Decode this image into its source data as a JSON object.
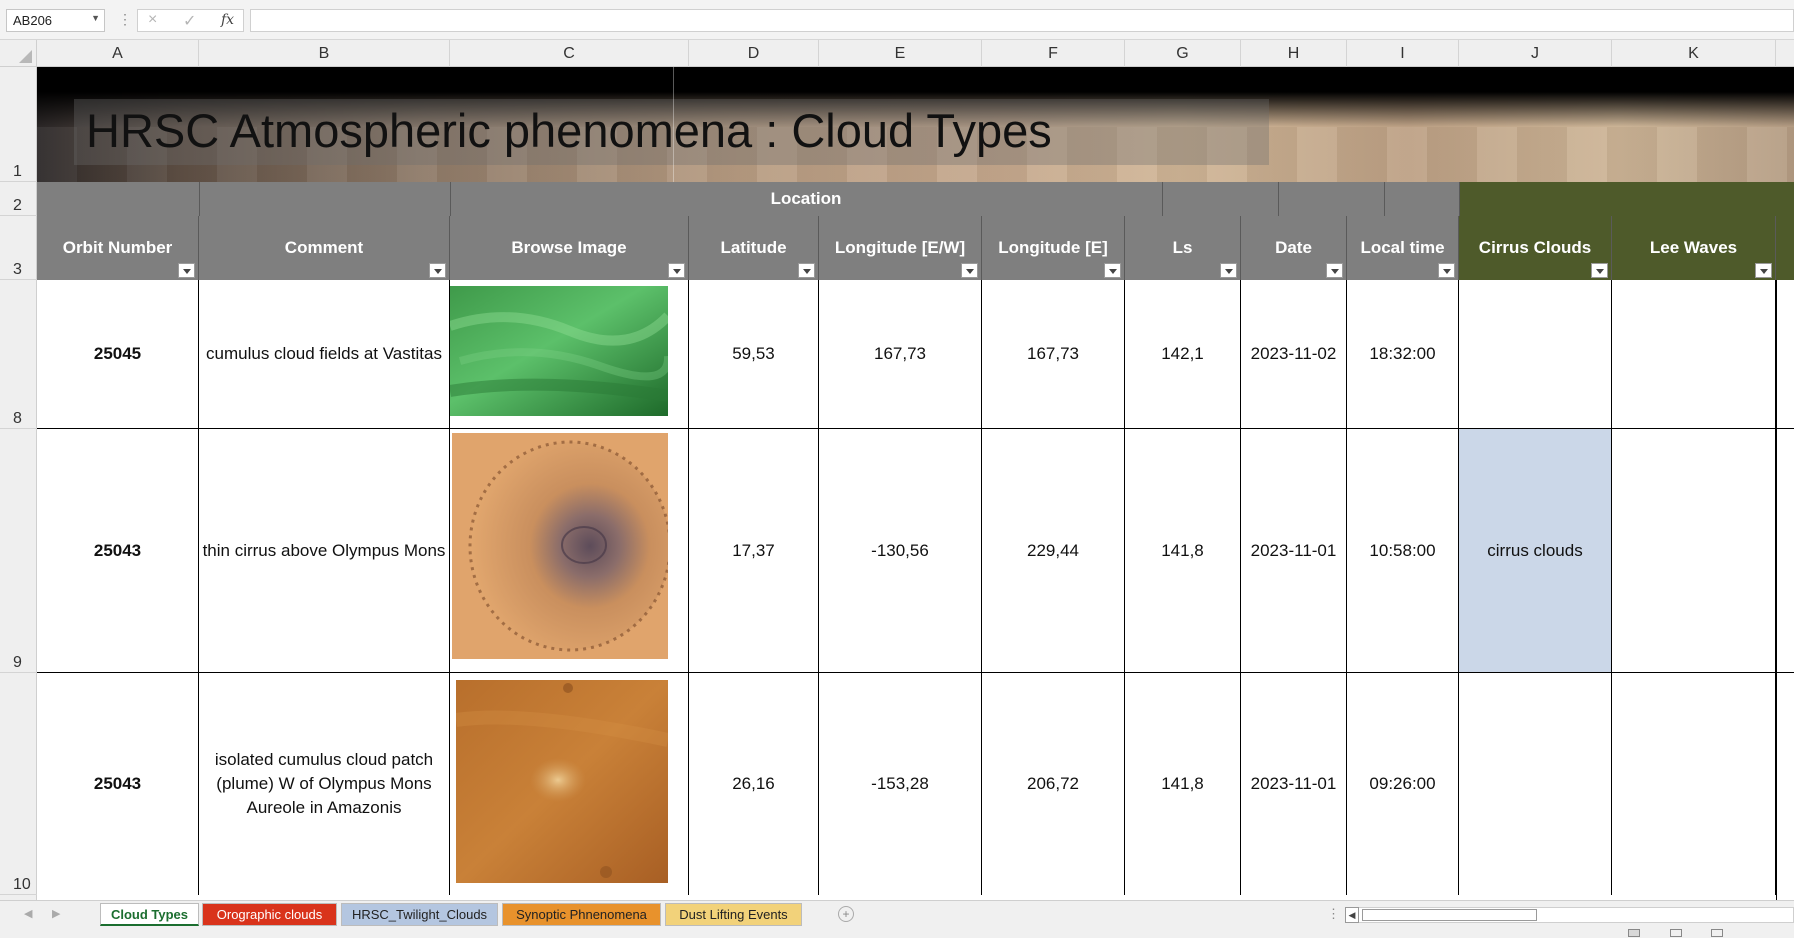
{
  "formula_bar": {
    "name_box": "AB206",
    "cancel_icon": "×",
    "enter_icon": "✓",
    "fx_label": "fx",
    "formula": ""
  },
  "columns": [
    "A",
    "B",
    "C",
    "D",
    "E",
    "F",
    "G",
    "H",
    "I",
    "J",
    "K"
  ],
  "row_numbers": [
    "1",
    "2",
    "3",
    "8",
    "9",
    "10"
  ],
  "banner": {
    "title": "HRSC Atmospheric phenomena : Cloud Types"
  },
  "header": {
    "group_label": "Location",
    "columns": [
      "Orbit Number",
      "Comment",
      "Browse Image",
      "Latitude",
      "Longitude [E/W]",
      "Longitude [E]",
      "Ls",
      "Date",
      "Local time",
      "Cirrus Clouds",
      "Lee Waves"
    ]
  },
  "rows": [
    {
      "orbit": "25045",
      "comment": "cumulus cloud fields at Vastitas",
      "image": "green-cloud-thumbnail",
      "latitude": "59,53",
      "longitude_ew": "167,73",
      "longitude_e": "167,73",
      "ls": "142,1",
      "date": "2023-11-02",
      "local_time": "18:32:00",
      "cirrus": "",
      "lee_waves": ""
    },
    {
      "orbit": "25043",
      "comment": "thin cirrus above Olympus Mons",
      "image": "olympus-mons-thumbnail",
      "latitude": "17,37",
      "longitude_ew": "-130,56",
      "longitude_e": "229,44",
      "ls": "141,8",
      "date": "2023-11-01",
      "local_time": "10:58:00",
      "cirrus": "cirrus clouds",
      "lee_waves": ""
    },
    {
      "orbit": "25043",
      "comment": "isolated cumulus cloud patch (plume) W of Olympus Mons Aureole in Amazonis",
      "image": "amazonis-plume-thumbnail",
      "latitude": "26,16",
      "longitude_ew": "-153,28",
      "longitude_e": "206,72",
      "ls": "141,8",
      "date": "2023-11-01",
      "local_time": "09:26:00",
      "cirrus": "",
      "lee_waves": ""
    }
  ],
  "tabs": [
    {
      "label": "Cloud Types",
      "color": "#ffffff"
    },
    {
      "label": "Orographic clouds",
      "color": "#d9331b"
    },
    {
      "label": "HRSC_Twilight_Clouds",
      "color": "#b4c6e0"
    },
    {
      "label": "Synoptic Phnenomena",
      "color": "#e8922c"
    },
    {
      "label": "Dust Lifting Events",
      "color": "#f2d27a"
    }
  ],
  "colors": {
    "header_gray": "#7f7f7f",
    "header_olive": "#4e5a2a",
    "cirrus_fill": "#cbd7e8",
    "active_tab_text": "#1b6e2f"
  }
}
